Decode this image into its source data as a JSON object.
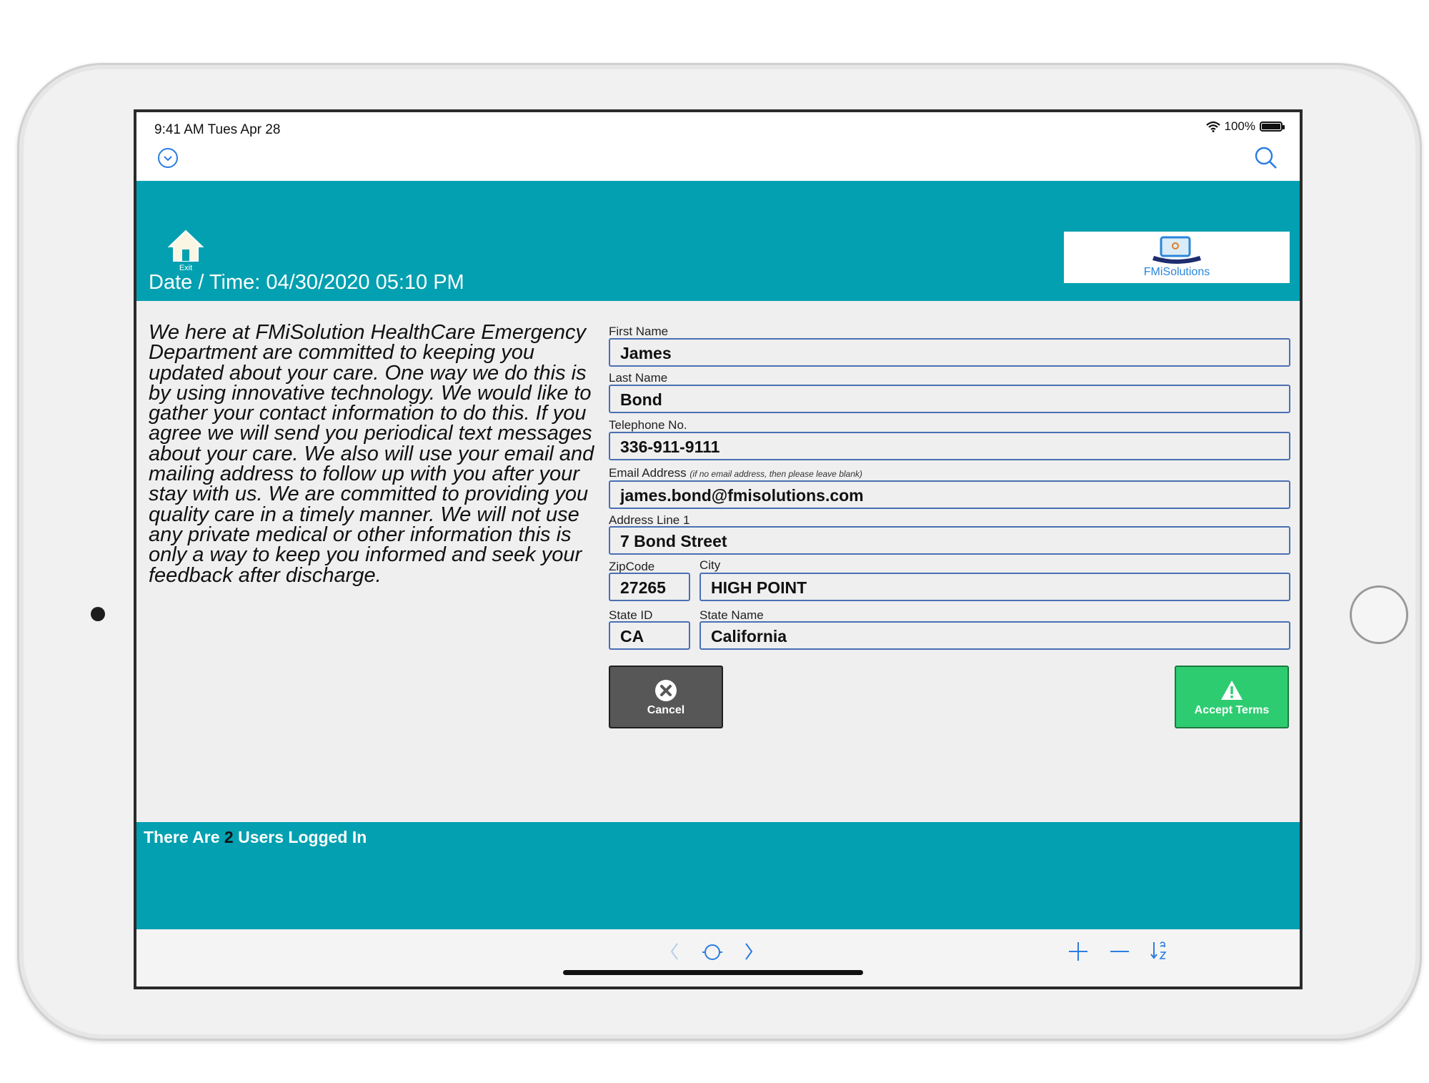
{
  "status_bar": {
    "time": "9:41 AM  Tues Apr 28",
    "battery": "100%"
  },
  "header": {
    "exit_label": "Exit",
    "datetime": "Date / Time: 04/30/2020 05:10 PM",
    "logo_text": "FMiSolutions"
  },
  "intro_text": "We here at FMiSolution HealthCare Emergency Department are committed to keeping you updated about your care. One way we do this is by using innovative technology. We would like to gather your contact information to do this. If you agree we will send you periodical text messages about your care. We also will use your email and mailing address to follow up with you after your stay with us. We are committed to providing you quality care in a timely manner. We will not use any private medical or other information this is only a way to keep you informed and seek your feedback after discharge.",
  "form": {
    "first_name": {
      "label": "First Name",
      "value": "James"
    },
    "last_name": {
      "label": "Last Name",
      "value": "Bond"
    },
    "telephone": {
      "label": "Telephone No.",
      "value": "336-911-9111"
    },
    "email": {
      "label": "Email Address",
      "hint": "(if no email address, then please leave blank)",
      "value": "james.bond@fmisolutions.com"
    },
    "address1": {
      "label": "Address Line 1",
      "value": "7 Bond Street"
    },
    "zip": {
      "label": "ZipCode",
      "value": "27265"
    },
    "city": {
      "label": "City",
      "value": "HIGH POINT"
    },
    "state_id": {
      "label": "State ID",
      "value": "CA"
    },
    "state_name": {
      "label": "State Name",
      "value": "California"
    }
  },
  "buttons": {
    "cancel": "Cancel",
    "accept": "Accept Terms"
  },
  "footer": {
    "users_prefix": "There Are",
    "users_count": "2",
    "users_suffix": "Users Logged In"
  },
  "colors": {
    "teal": "#02a0b0",
    "field_border": "#4a6fb3",
    "accept_green": "#2ecc71",
    "cancel_gray": "#575757",
    "ios_blue": "#2a7de1"
  }
}
